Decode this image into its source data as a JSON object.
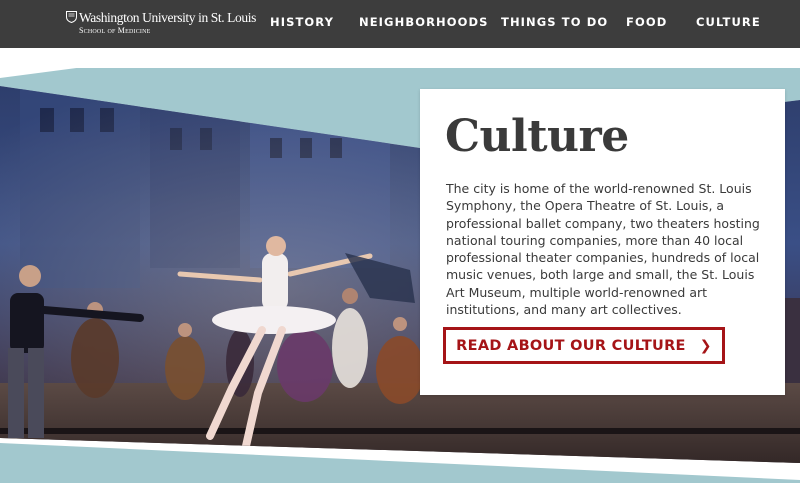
{
  "brand": {
    "university": "Washington University in St. Louis",
    "school": "School of Medicine",
    "logo_icon": "shield-icon"
  },
  "nav": {
    "items": [
      {
        "label": "HISTORY"
      },
      {
        "label": "NEIGHBORHOODS"
      },
      {
        "label": "THINGS TO DO"
      },
      {
        "label": "FOOD"
      },
      {
        "label": "CULTURE"
      }
    ]
  },
  "hero": {
    "image_subject": "ballet performance on stage",
    "accent_color": "#a2c8ce"
  },
  "card": {
    "title": "Culture",
    "body": "The city is home of the world-renowned St. Louis Symphony, the Opera Theatre of St. Louis, a professional ballet company, two theaters hosting national touring companies, more than 40 local professional theater companies, hundreds of local music venues, both large and small, the St. Louis Art Museum, multiple world-renowned art institutions, and many art collectives.",
    "cta_label": "READ ABOUT OUR CULTURE",
    "cta_icon": "chevron-right-icon",
    "cta_color": "#a51417"
  }
}
